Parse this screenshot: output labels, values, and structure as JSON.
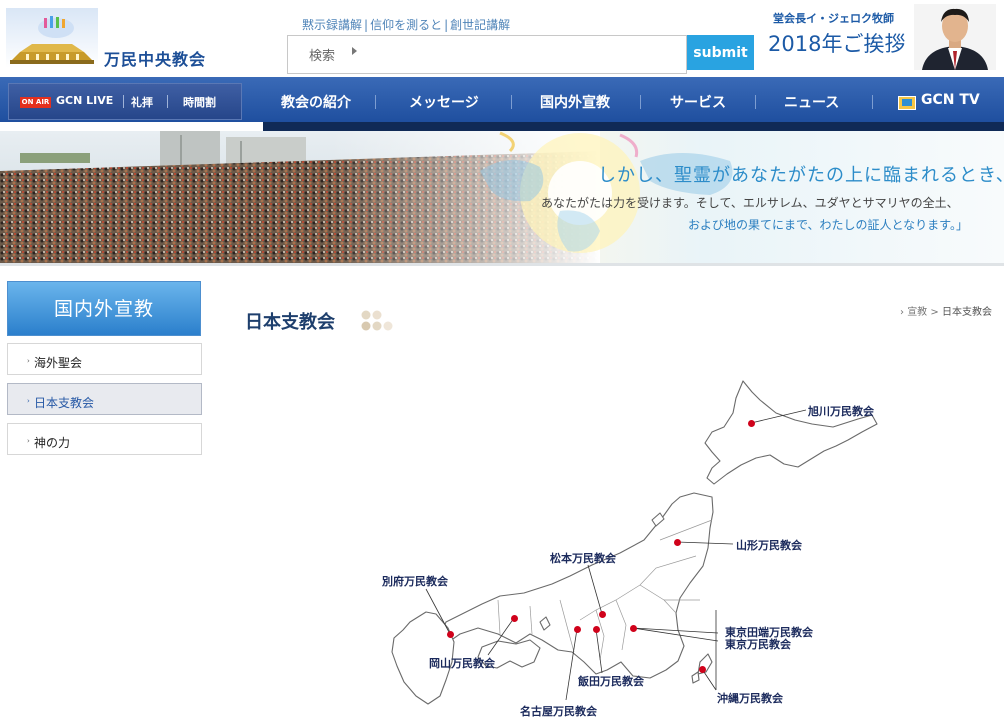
{
  "header": {
    "logo_text": "万民中央教会",
    "top_links": [
      "黙示録講解",
      "信仰を測ると",
      "創世記講解"
    ],
    "search": {
      "label": "検索",
      "placeholder": "",
      "submit_label": "submit"
    },
    "greeting": {
      "subtitle": "堂会長イ・ジェロク牧師",
      "title": "2018年ご挨拶"
    }
  },
  "live_bar": {
    "onair_badge": "ON AIR",
    "items": [
      "GCN LIVE",
      "礼拝",
      "時間割"
    ]
  },
  "nav": {
    "items": [
      "教会の紹介",
      "メッセージ",
      "国内外宣教",
      "サービス",
      "ニュース",
      "GCN TV"
    ]
  },
  "banner": {
    "title": "しかし、聖霊があなたがたの上に臨まれるとき、",
    "line2": "あなたがたは力を受けます。そして、エルサレム、ユダヤとサマリヤの全土、",
    "line3": "および地の果てにまで、わたしの証人となります。」"
  },
  "sidebar": {
    "heading": "国内外宣教",
    "items": [
      {
        "label": "海外聖会",
        "active": false
      },
      {
        "label": "日本支教会",
        "active": true
      },
      {
        "label": "神の力",
        "active": false
      }
    ]
  },
  "main": {
    "page_title": "日本支教会",
    "breadcrumb": [
      "宣教",
      "日本支教会"
    ]
  },
  "map": {
    "marker_color": "#d0021b",
    "churches": [
      "旭川万民教会",
      "山形万民教会",
      "松本万民教会",
      "別府万民教会",
      "東京田端万民教会",
      "東京万民教会",
      "岡山万民教会",
      "飯田万民教会",
      "沖縄万民教会",
      "名古屋万民教会"
    ]
  },
  "colors": {
    "nav_blue": "#2a5aa8",
    "accent_blue": "#29a3e1",
    "logo_blue": "#1d4f97"
  }
}
